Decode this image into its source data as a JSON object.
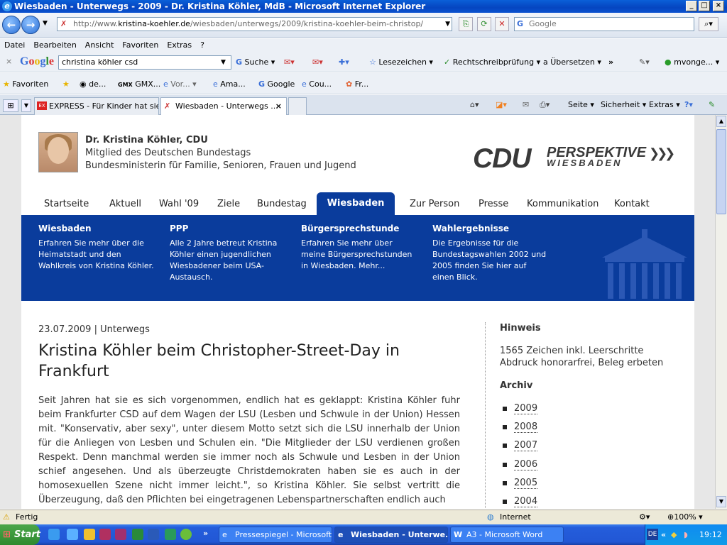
{
  "window": {
    "title": "Wiesbaden - Unterwegs - 2009 - Dr. Kristina Köhler, MdB - Microsoft Internet Explorer"
  },
  "address": {
    "url_prefix": "http://www.",
    "url_domain": "kristina-koehler.de",
    "url_path": "/wiesbaden/unterwegs/2009/kristina-koehler-beim-christop/",
    "search_placeholder": "Google"
  },
  "menu": [
    "Datei",
    "Bearbeiten",
    "Ansicht",
    "Favoriten",
    "Extras",
    "?"
  ],
  "google_toolbar": {
    "logo": "Google",
    "query": "christina köhler csd",
    "search": "Suche",
    "bookmarks": "Lesezeichen",
    "spellcheck": "Rechtschreibprüfung",
    "translate": "Übersetzen",
    "user": "mvonge..."
  },
  "favorites_bar": {
    "favorites": "Favoriten",
    "items": [
      "de...",
      "GMX...",
      "Vor...",
      "Ama...",
      "Google",
      "Cou...",
      "Fr..."
    ]
  },
  "tabs": [
    {
      "label": "EXPRESS - Für Kinder hat sie..."
    },
    {
      "label": "Wiesbaden - Unterwegs ..."
    }
  ],
  "command_bar": {
    "page": "Seite",
    "security": "Sicherheit",
    "tools": "Extras"
  },
  "header": {
    "name": "Dr. Kristina Köhler, CDU",
    "line1": "Mitglied des Deutschen Bundestags",
    "line2": "Bundesministerin für Familie, Senioren, Frauen und Jugend",
    "logo_cdu": "CDU",
    "logo_perspektive": "PERSPEKTIVE",
    "logo_city": "WIESBADEN"
  },
  "nav": [
    "Startseite",
    "Aktuell",
    "Wahl '09",
    "Ziele",
    "Bundestag",
    "Wiesbaden",
    "Zur Person",
    "Presse",
    "Kommunikation",
    "Kontakt"
  ],
  "nav_active": "Wiesbaden",
  "subnav": [
    {
      "title": "Wiesbaden",
      "text": "Erfahren Sie mehr über die Heimatstadt und den Wahlkreis von Kristina Köhler."
    },
    {
      "title": "PPP",
      "text": "Alle 2 Jahre betreut Kristina Köhler einen jugendlichen Wiesbadener beim USA-Austausch."
    },
    {
      "title": "Bürgersprechstunde",
      "text": "Erfahren Sie mehr über meine Bürgersprechstunden in Wiesbaden. Mehr..."
    },
    {
      "title": "Wahlergebnisse",
      "text": "Die Ergebnisse für die Bundestagswahlen 2002 und 2005 finden Sie hier auf einen Blick."
    }
  ],
  "article": {
    "date": "23.07.2009",
    "separator": "|",
    "category": "Unterwegs",
    "headline": "Kristina Köhler beim Christopher-Street-Day in Frankfurt",
    "body": "Seit Jahren hat sie es sich vorgenommen, endlich hat es geklappt: Kristina Köhler fuhr beim Frankfurter CSD auf dem Wagen der LSU (Lesben und Schwule in der Union) Hessen mit. \"Konservativ, aber sexy\", unter diesem Motto setzt sich die LSU innerhalb der Union für die Anliegen von Lesben und Schulen ein. \"Die Mitglieder der LSU verdienen großen Respekt. Denn manchmal werden sie immer noch als Schwule und Lesben in der Union schief angesehen. Und als überzeugte Christdemokraten haben sie es auch in der homosexuellen Szene nicht immer leicht.\", so Kristina Köhler. Sie selbst vertritt die Überzeugung, daß den Pflichten bei eingetragenen Lebenspartnerschaften endlich auch"
  },
  "sidebar": {
    "hint_title": "Hinweis",
    "hint_line1": "1565 Zeichen inkl. Leerschritte",
    "hint_line2": "Abdruck honorarfrei, Beleg erbeten",
    "archive_title": "Archiv",
    "archive": [
      "2009",
      "2008",
      "2007",
      "2006",
      "2005",
      "2004"
    ]
  },
  "status": {
    "text": "Fertig",
    "zone": "Internet",
    "zoom": "100%"
  },
  "taskbar": {
    "start": "Start",
    "items": [
      "Pressespiegel - Microsoft...",
      "Wiesbaden - Unterwe...",
      "A3 - Microsoft Word"
    ],
    "lang": "DE",
    "clock": "19:12"
  },
  "colors": {
    "brand_blue": "#0a3c9c",
    "title_bar": "#0545c0",
    "taskbar": "#245ddb"
  }
}
